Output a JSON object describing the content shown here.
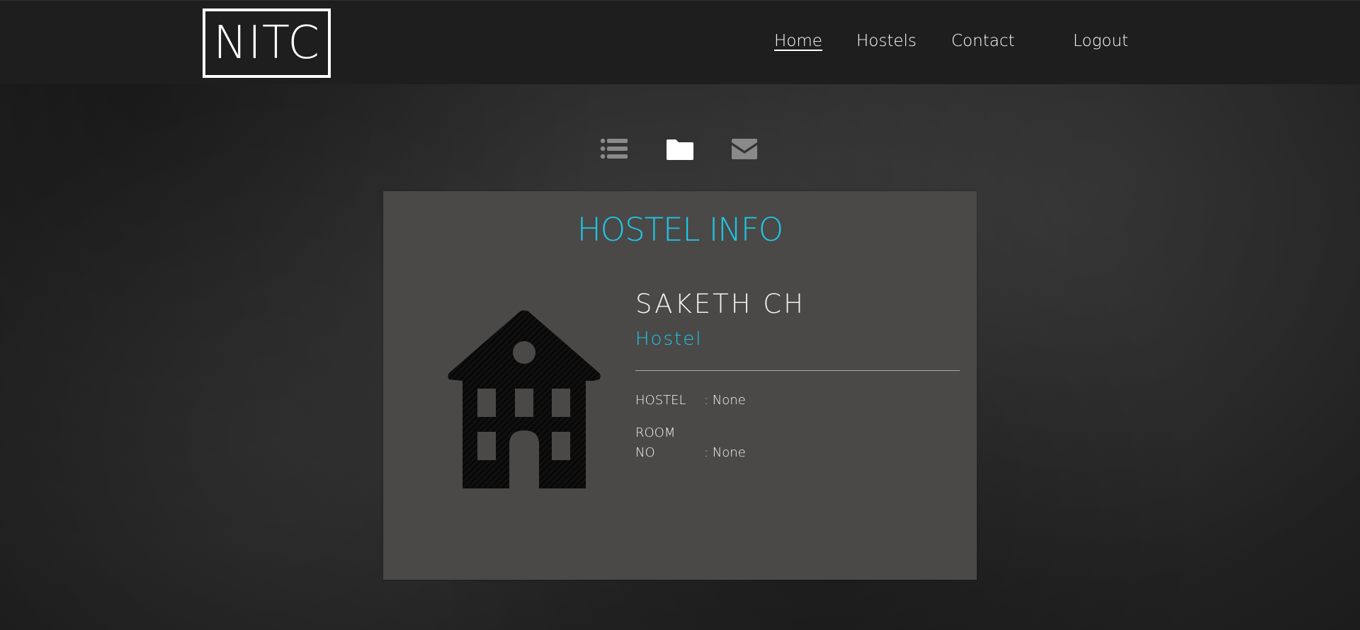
{
  "header": {
    "logo_text": "NITC",
    "nav": [
      {
        "label": "Home",
        "active": true
      },
      {
        "label": "Hostels",
        "active": false
      },
      {
        "label": "Contact",
        "active": false
      },
      {
        "label": "Logout",
        "active": false
      }
    ]
  },
  "toolbar_icons": [
    {
      "icon": "list-icon",
      "active": false
    },
    {
      "icon": "folder-icon",
      "active": true
    },
    {
      "icon": "envelope-icon",
      "active": false
    }
  ],
  "card": {
    "title": "HOSTEL INFO",
    "name": "SAKETH CH",
    "subtitle": "Hostel",
    "fields": [
      {
        "label": "HOSTEL",
        "value": ": None"
      },
      {
        "label_line1": "ROOM",
        "label_line2": "NO",
        "value": ": None"
      }
    ],
    "image_icon": "house-icon"
  },
  "colors": {
    "accent": "#1fc7e6",
    "header_bg": "#1e1e1e",
    "card_bg": "#4a4948",
    "icon_inactive": "#8a8a8a",
    "icon_active": "#ffffff"
  }
}
